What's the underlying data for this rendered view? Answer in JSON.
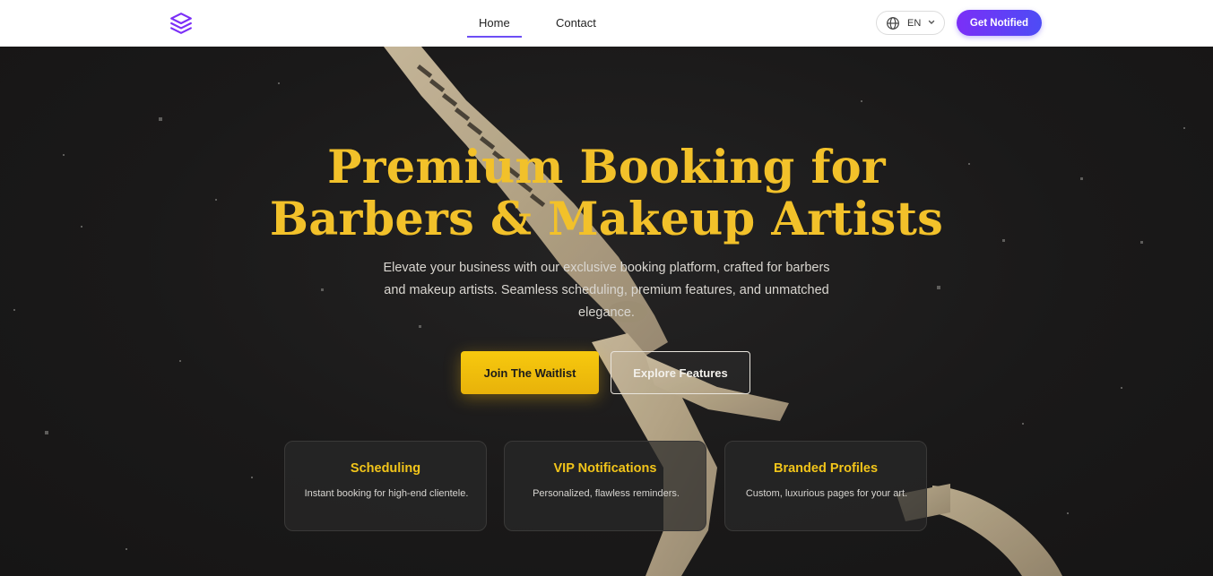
{
  "nav": {
    "logo_icon": "layers-icon",
    "links": [
      {
        "label": "Home",
        "active": true
      },
      {
        "label": "Contact",
        "active": false
      }
    ],
    "language": {
      "icon": "globe-icon",
      "label": "EN",
      "dropdown_icon": "chevron-down-icon"
    },
    "cta_label": "Get Notified"
  },
  "hero": {
    "title_line1": "Premium Booking for",
    "title_line2": "Barbers & Makeup Artists",
    "subtitle": "Elevate your business with our exclusive booking platform, crafted for barbers and makeup artists. Seamless scheduling, premium features, and unmatched elegance.",
    "primary_button": "Join The Waitlist",
    "secondary_button": "Explore Features"
  },
  "features": [
    {
      "title": "Scheduling",
      "description": "Instant booking for high-end clientele."
    },
    {
      "title": "VIP Notifications",
      "description": "Personalized, flawless reminders."
    },
    {
      "title": "Branded Profiles",
      "description": "Custom, luxurious pages for your art."
    }
  ],
  "colors": {
    "accent_gold": "#f2c12a",
    "accent_purple": "#7b2ff7",
    "accent_blue": "#4d4cf5",
    "background": "#1a1919"
  }
}
